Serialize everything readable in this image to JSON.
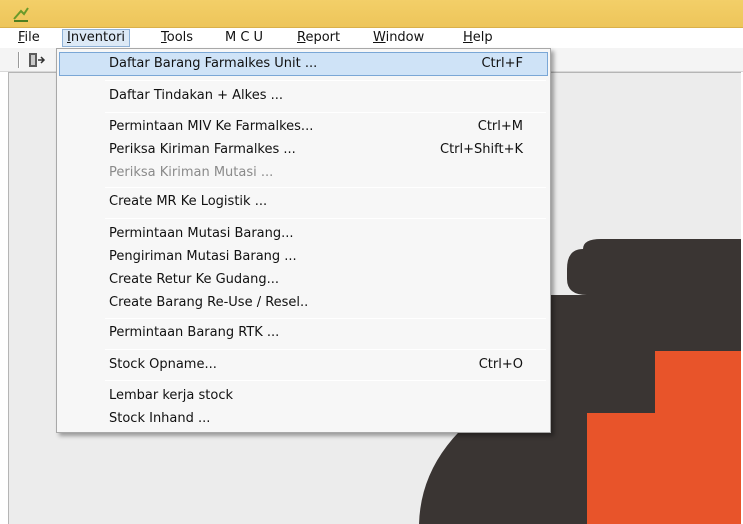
{
  "menubar": {
    "menus": [
      {
        "mnemonic": "F",
        "rest": "ile"
      },
      {
        "mnemonic": "I",
        "rest": "nventori"
      },
      {
        "mnemonic": "T",
        "rest": "ools"
      },
      {
        "mnemonic": "",
        "rest": "M C U"
      },
      {
        "mnemonic": "R",
        "rest": "eport"
      },
      {
        "mnemonic": "W",
        "rest": "indow"
      },
      {
        "mnemonic": "H",
        "rest": "elp"
      }
    ],
    "active_menu": "Inventori"
  },
  "toolbar": {
    "exit_icon": "exit-door-icon"
  },
  "inventori_menu": {
    "items": [
      {
        "label": "Daftar Barang Farmalkes Unit ...",
        "shortcut": "Ctrl+F"
      },
      {
        "label": "Daftar Tindakan + Alkes ...",
        "shortcut": ""
      },
      {
        "label": "Permintaan MIV Ke Farmalkes...",
        "shortcut": "Ctrl+M"
      },
      {
        "label": "Periksa Kiriman Farmalkes ...",
        "shortcut": "Ctrl+Shift+K"
      },
      {
        "label": "Periksa  Kiriman Mutasi ...",
        "shortcut": ""
      },
      {
        "label": "Create MR Ke Logistik ...",
        "shortcut": ""
      },
      {
        "label": "Permintaan Mutasi  Barang...",
        "shortcut": ""
      },
      {
        "label": "Pengiriman Mutasi Barang ...",
        "shortcut": ""
      },
      {
        "label": "Create Retur Ke Gudang...",
        "shortcut": ""
      },
      {
        "label": "Create Barang Re-Use / Resel..",
        "shortcut": ""
      },
      {
        "label": "Permintaan Barang RTK ...",
        "shortcut": ""
      },
      {
        "label": "Stock Opname...",
        "shortcut": "Ctrl+O"
      },
      {
        "label": "Lembar kerja stock",
        "shortcut": ""
      },
      {
        "label": "Stock Inhand ...",
        "shortcut": ""
      }
    ],
    "highlighted_item": "Daftar Barang Farmalkes Unit ...",
    "disabled_item": "Periksa  Kiriman Mutasi ..."
  },
  "colors": {
    "titlebar": "#edc55a",
    "highlight": "#cfe3f7",
    "logo_dark": "#3a3533",
    "logo_orange": "#e8542a"
  }
}
